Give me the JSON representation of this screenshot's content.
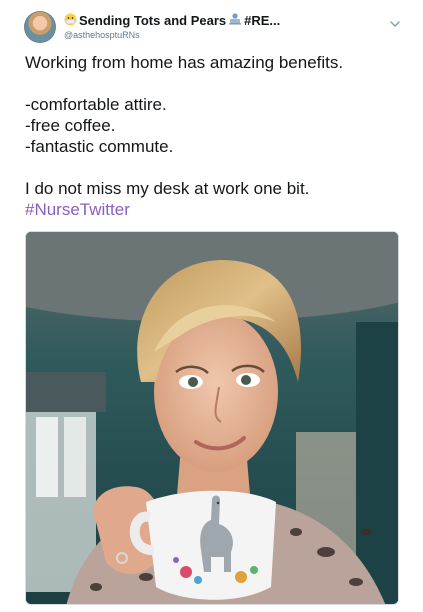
{
  "author": {
    "display_name": "Sending Tots and Pears",
    "display_suffix": "#RE...",
    "handle": "@asthehosptuRNs"
  },
  "tweet": {
    "line1": "Working from home has amazing benefits.",
    "line2": "-comfortable attire.",
    "line3": "-free coffee.",
    "line4": "-fantastic commute.",
    "line5": "I do not miss my desk at work one bit.",
    "hashtag": "#NurseTwitter"
  },
  "colors": {
    "hashtag": "#8b5fbf",
    "handle": "#657786"
  },
  "icons": {
    "mask_emoji": "face-with-medical-mask-icon",
    "laptop_emoji": "laptop-person-icon",
    "menu": "chevron-down-icon"
  }
}
